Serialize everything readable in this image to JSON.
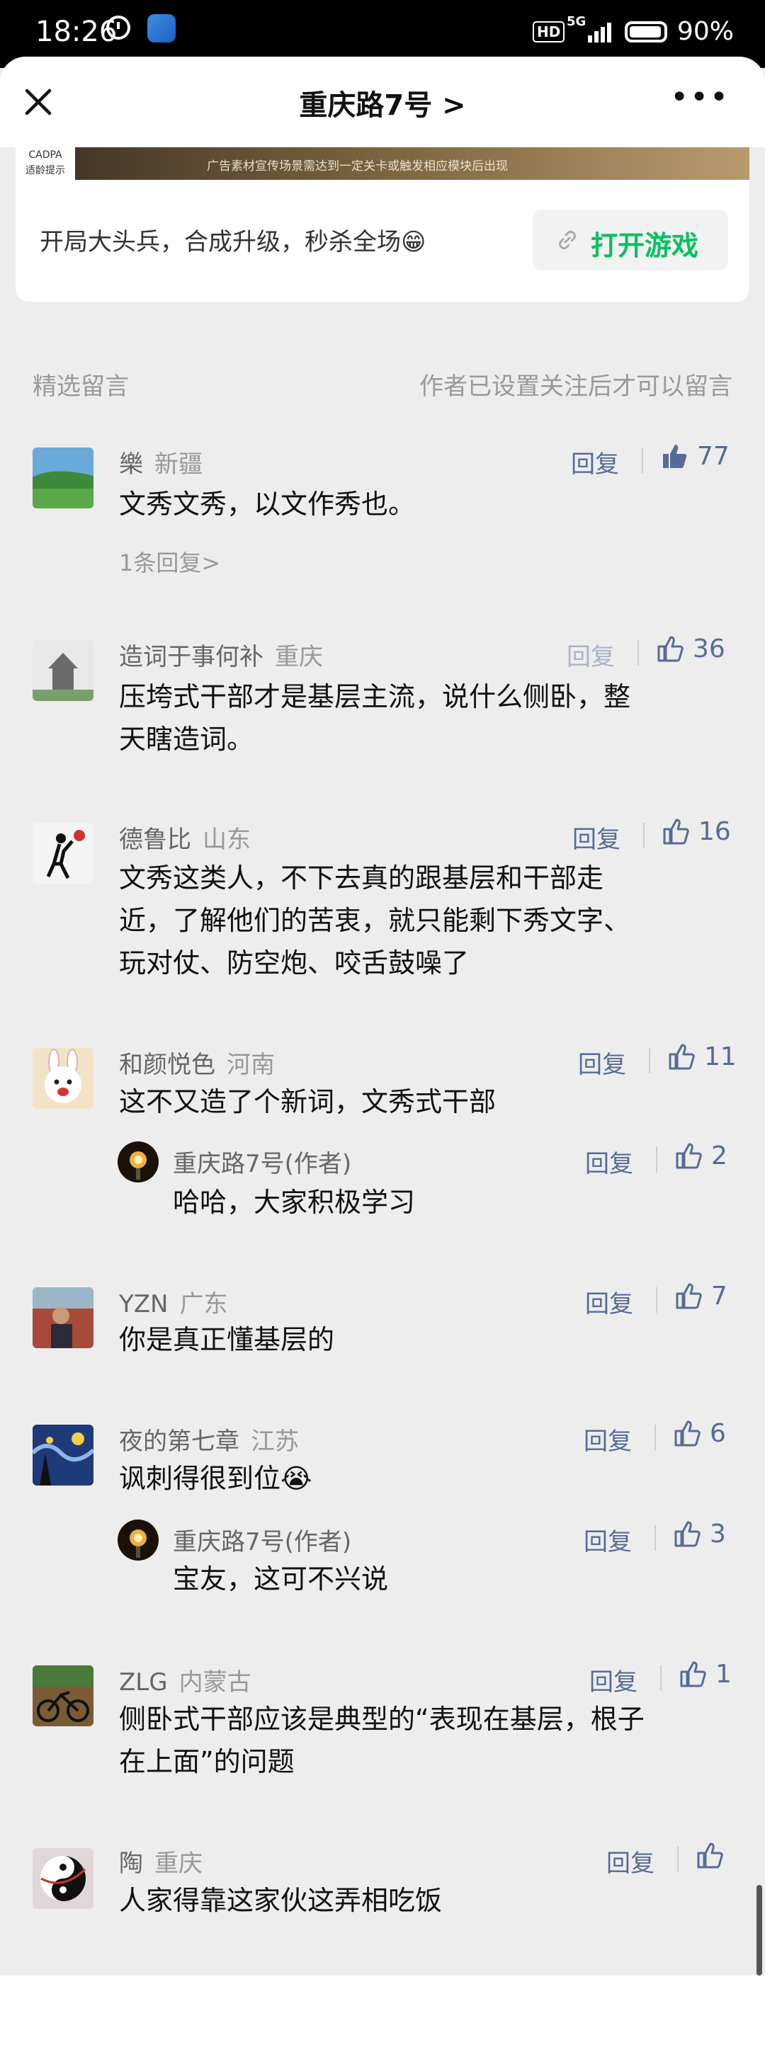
{
  "status_bar": {
    "time": "18:26",
    "hd": "HD",
    "network": "5G",
    "battery": "90%"
  },
  "header": {
    "title": "重庆路7号 >"
  },
  "ad": {
    "badge_line1": "CADPA",
    "badge_line2": "适龄提示",
    "notice": "广告素材宣传场景需达到一定关卡或触发相应模块后出现",
    "text": "开局大头兵，合成升级，秒杀全场😁",
    "button": "打开游戏"
  },
  "section": {
    "left": "精选留言",
    "right": "作者已设置关注后才可以留言"
  },
  "comments": [
    {
      "name": "樂",
      "loc": "新疆",
      "reply": "回复",
      "likes": "77",
      "body": [
        "文秀文秀，以文作秀也。"
      ],
      "sub": "1条回复>"
    },
    {
      "name": "造词于事何补",
      "loc": "重庆",
      "reply": "回复",
      "likes": "36",
      "body": [
        "压垮式干部才是基层主流，说什么侧卧，整",
        "天瞎造词。"
      ]
    },
    {
      "name": "德鲁比",
      "loc": "山东",
      "reply": "回复",
      "likes": "16",
      "body": [
        "文秀这类人，不下去真的跟基层和干部走",
        "近，了解他们的苦衷，就只能剩下秀文字、",
        "玩对仗、防空炮、咬舌鼓噪了"
      ]
    },
    {
      "name": "和颜悦色",
      "loc": "河南",
      "reply": "回复",
      "likes": "11",
      "body": [
        "这不又造了个新词，文秀式干部"
      ],
      "author_reply": {
        "name": "重庆路7号(作者)",
        "reply": "回复",
        "likes": "2",
        "body": "哈哈，大家积极学习"
      }
    },
    {
      "name": "YZN",
      "loc": "广东",
      "reply": "回复",
      "likes": "7",
      "body": [
        "你是真正懂基层的"
      ]
    },
    {
      "name": "夜的第七章",
      "loc": "江苏",
      "reply": "回复",
      "likes": "6",
      "body": [
        "讽刺得很到位😭"
      ],
      "author_reply": {
        "name": "重庆路7号(作者)",
        "reply": "回复",
        "likes": "3",
        "body": "宝友，这可不兴说"
      }
    },
    {
      "name": "ZLG",
      "loc": "内蒙古",
      "reply": "回复",
      "likes": "1",
      "body": [
        "侧卧式干部应该是典型的“表现在基层，根子",
        "在上面”的问题"
      ]
    },
    {
      "name": "陶",
      "loc": "重庆",
      "reply": "回复",
      "likes": "",
      "body": [
        "人家得靠这家伙这弄相吃饭"
      ]
    }
  ]
}
